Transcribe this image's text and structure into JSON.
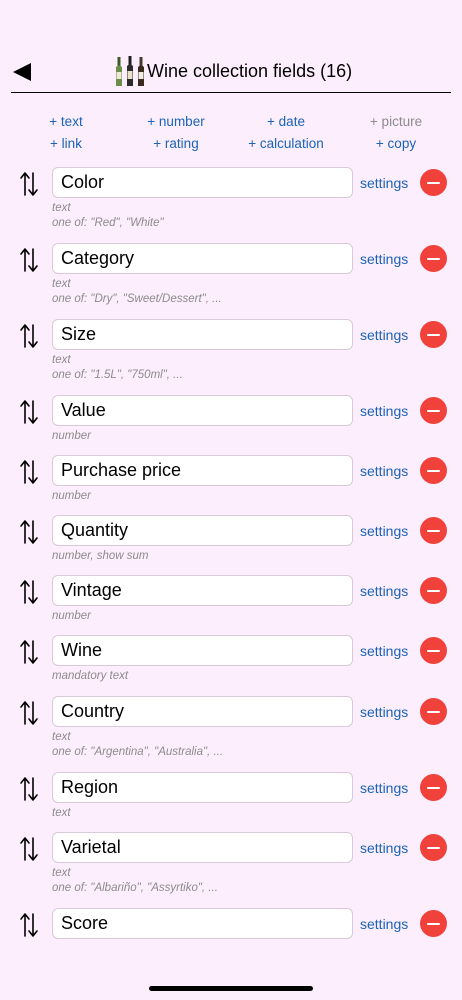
{
  "header": {
    "title": "Wine collection fields (16)",
    "icon": "wine-bottles-icon"
  },
  "add_links": {
    "row1": [
      "+ text",
      "+ number",
      "+ date",
      "+ picture"
    ],
    "row2": [
      "+ link",
      "+ rating",
      "+ calculation",
      "+ copy"
    ],
    "disabled": [
      "+ picture"
    ]
  },
  "settings_label": "settings",
  "fields": [
    {
      "name": "Color",
      "type": "text",
      "options": "one of: \"Red\", \"White\""
    },
    {
      "name": "Category",
      "type": "text",
      "options": "one of: \"Dry\", \"Sweet/Dessert\", ..."
    },
    {
      "name": "Size",
      "type": "text",
      "options": "one of: \"1.5L\", \"750ml\", ..."
    },
    {
      "name": "Value",
      "type": "number",
      "options": ""
    },
    {
      "name": "Purchase price",
      "type": "number",
      "options": ""
    },
    {
      "name": "Quantity",
      "type": "number, show sum",
      "options": ""
    },
    {
      "name": "Vintage",
      "type": "number",
      "options": ""
    },
    {
      "name": "Wine",
      "type": "mandatory text",
      "options": ""
    },
    {
      "name": "Country",
      "type": "text",
      "options": "one of: \"Argentina\", \"Australia\", ..."
    },
    {
      "name": "Region",
      "type": "text",
      "options": ""
    },
    {
      "name": "Varietal",
      "type": "text",
      "options": "one of: \"Albariño\", \"Assyrtiko\", ..."
    },
    {
      "name": "Score",
      "type": "",
      "options": ""
    }
  ],
  "colors": {
    "background": "#fceefc",
    "link": "#1a63b8",
    "remove": "#f0413a",
    "disabled": "#8c8c8c"
  }
}
